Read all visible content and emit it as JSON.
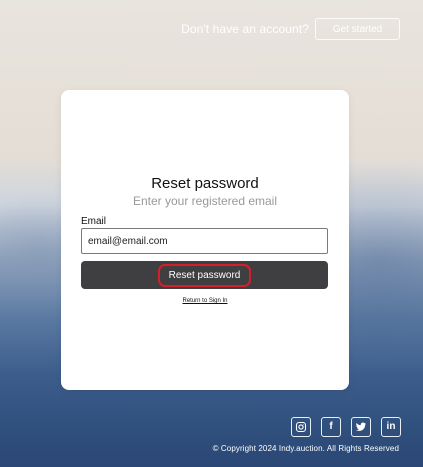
{
  "header": {
    "prompt": "Don't have an account?",
    "get_started_label": "Get started"
  },
  "form": {
    "title": "Reset password",
    "subtitle": "Enter your registered email",
    "email_label": "Email",
    "email_value": "email@email.com",
    "reset_button_label": "Reset password",
    "return_link": "Return to Sign In"
  },
  "footer": {
    "social_icons": [
      "instagram-icon",
      "facebook-icon",
      "twitter-icon",
      "linkedin-icon"
    ],
    "facebook_glyph": "f",
    "linkedin_glyph": "in",
    "copyright": "© Copyright 2024 Indy.auction. All Rights Reserved"
  },
  "colors": {
    "button_bg": "#3f3f42",
    "highlight": "#d2202a"
  }
}
